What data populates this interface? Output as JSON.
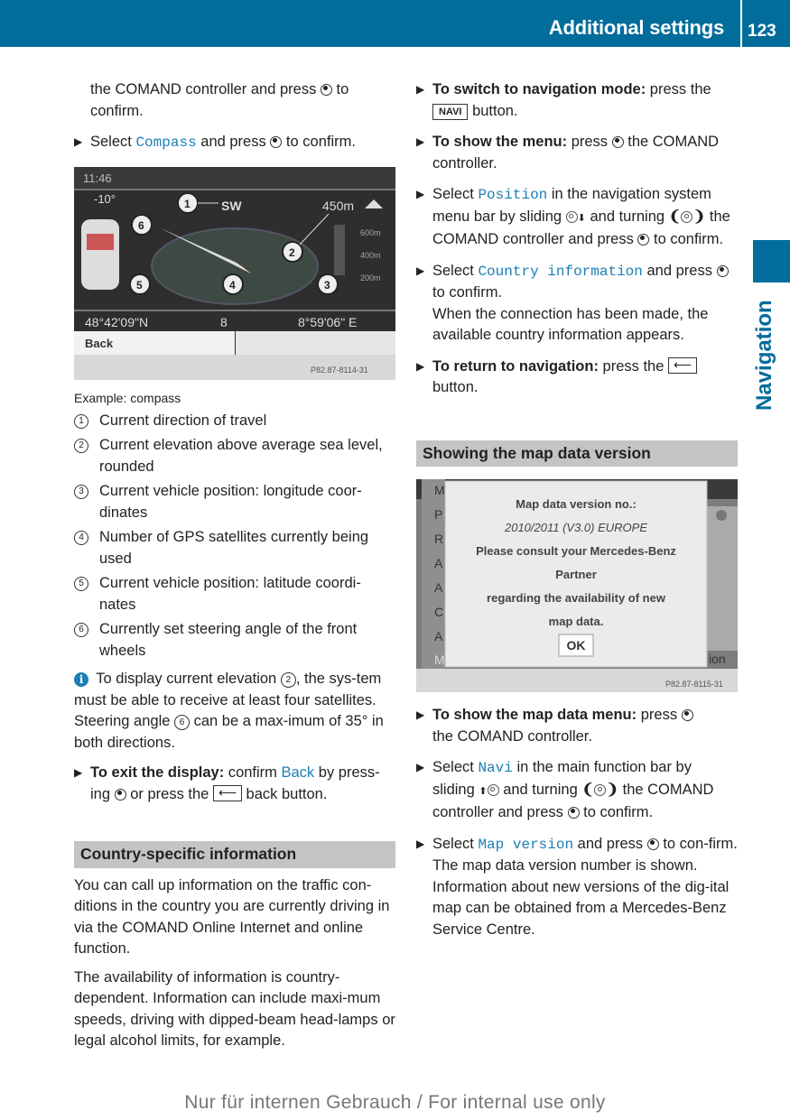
{
  "header": {
    "title": "Additional settings",
    "page_number": "123"
  },
  "side_tab": {
    "label": "Navigation"
  },
  "left_column": {
    "intro_cont": "the COMAND controller and press",
    "intro_cont_end": "to",
    "intro_cont_2": "confirm.",
    "step_select_compass": {
      "pre": "Select",
      "keyword": "Compass",
      "post": "and press",
      "end": "to confirm."
    },
    "compass_screen": {
      "time": "11:46",
      "steering_angle": "-10°",
      "direction": "SW",
      "elevation": "450m",
      "scale": [
        "600m",
        "400m",
        "200m"
      ],
      "latitude": "48°42'09\"N",
      "satellites": "8",
      "longitude": "8°59'06\" E",
      "back_button": "Back",
      "image_code": "P82.87-8114-31",
      "callouts": [
        "1",
        "2",
        "3",
        "4",
        "5",
        "6"
      ]
    },
    "caption": "Example: compass",
    "legend": [
      {
        "num": "1",
        "text": "Current direction of travel"
      },
      {
        "num": "2",
        "text": "Current elevation above average sea level, rounded"
      },
      {
        "num": "3",
        "text": "Current vehicle position: longitude coor-dinates"
      },
      {
        "num": "4",
        "text": "Number of GPS satellites currently being used"
      },
      {
        "num": "5",
        "text": "Current vehicle position: latitude coordi-nates"
      },
      {
        "num": "6",
        "text": "Currently set steering angle of the front wheels"
      }
    ],
    "info": {
      "a": "To display current elevation",
      "n1": "2",
      "b": ", the sys-tem must be able to receive at least four satellites. Steering angle",
      "n2": "6",
      "c": "can be a max-imum of 35° in both directions."
    },
    "step_exit": {
      "bold": "To exit the display:",
      "pre": "confirm",
      "keyword": "Back",
      "mid": "by press-ing",
      "post": "or press the",
      "end": "back button."
    },
    "section_country": {
      "heading": "Country-specific information",
      "para1": "You can call up information on the traffic con-ditions in the country you are currently driving in via the COMAND Online Internet and online function.",
      "para2": "The availability of information is country-dependent. Information can include maxi-mum speeds, driving with dipped-beam head-lamps or legal alcohol limits, for example."
    }
  },
  "right_column": {
    "step_nav_mode": {
      "bold": "To switch to navigation mode:",
      "post": "press the",
      "key": "NAVI",
      "end": "button."
    },
    "step_show_menu": {
      "bold": "To show the menu:",
      "pre": "press",
      "post": "the COMAND controller."
    },
    "step_position": {
      "pre": "Select",
      "keyword": "Position",
      "a": "in the navigation system menu bar by sliding",
      "b": "and turning",
      "c": "the COMAND controller and press",
      "end": "to confirm."
    },
    "step_country": {
      "pre": "Select",
      "keyword": "Country information",
      "post": "and press",
      "end": "to confirm.",
      "result": "When the connection has been made, the available country information appears."
    },
    "step_return": {
      "bold": "To return to navigation:",
      "post": "press the",
      "end": "button."
    },
    "section_map": {
      "heading": "Showing the map data version"
    },
    "map_screen": {
      "menu_letters": [
        "M",
        "P",
        "R",
        "A",
        "A",
        "C",
        "A",
        "M"
      ],
      "dialog_lines": [
        "Map data version no.:",
        "2010/2011 (V3.0) EUROPE",
        "Please consult your Mercedes-Benz",
        "Partner",
        "regarding the availability of new",
        "map data."
      ],
      "ok_button": "OK",
      "right_fragment": "ion",
      "image_code": "P82.87-8115-31"
    },
    "step_map_menu": {
      "bold": "To show the map data menu:",
      "pre": "press",
      "post": "the COMAND controller."
    },
    "step_navi": {
      "pre": "Select",
      "keyword": "Navi",
      "a": "in the main function bar by sliding",
      "b": "and turning",
      "c": "the COMAND controller and press",
      "end": "to confirm."
    },
    "step_map_version": {
      "pre": "Select",
      "keyword": "Map version",
      "post": "and press",
      "end": "to con-firm.",
      "result": "The map data version number is shown. Information about new versions of the dig-ital map can be obtained from a Mercedes-Benz Service Centre."
    }
  },
  "footer": {
    "text": "Nur für internen Gebrauch / For internal use only"
  },
  "colors": {
    "brand_blue": "#026c9b",
    "keyword_blue": "#1a7fb4",
    "section_gray": "#c4c4c4"
  }
}
